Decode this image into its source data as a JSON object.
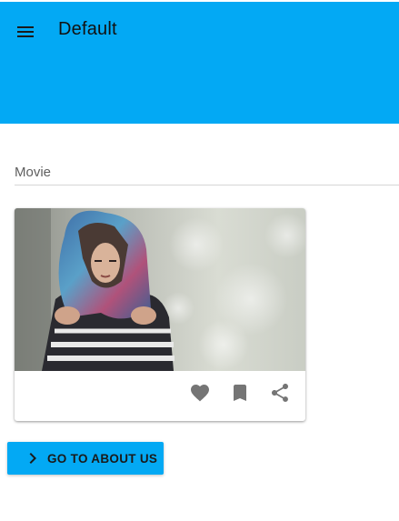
{
  "toolbar": {
    "title": "Default",
    "background": "#03A9F4",
    "menu_icon": "menu-icon"
  },
  "section": {
    "label": "Movie"
  },
  "card": {
    "media_icon": "photo-woman-scarf",
    "actions": [
      {
        "icon": "favorite-icon"
      },
      {
        "icon": "bookmark-icon"
      },
      {
        "icon": "share-icon"
      }
    ]
  },
  "about_button": {
    "label": "GO TO ABOUT US",
    "icon": "chevron-right-icon",
    "background": "#03A9F4"
  }
}
